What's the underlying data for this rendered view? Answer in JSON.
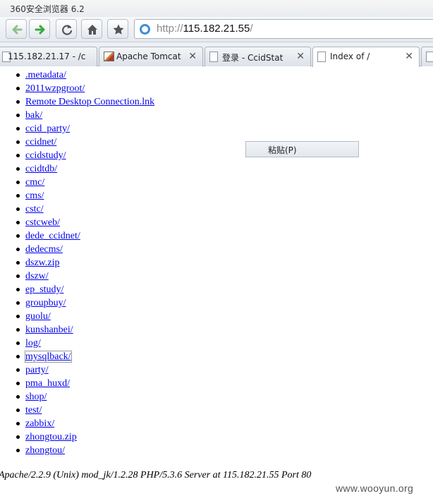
{
  "window": {
    "title": "360安全浏览器 6.2"
  },
  "address": {
    "scheme": "http://",
    "host": "115.182.21.55",
    "path": "/"
  },
  "tabs": [
    {
      "label": "115.182.21.17 - /c",
      "icon": "page-icon",
      "active": false
    },
    {
      "label": "Apache Tomcat",
      "icon": "tomcat-icon",
      "active": false
    },
    {
      "label": "登录 - CcidStat",
      "icon": "page-icon",
      "active": false
    },
    {
      "label": "Index of /",
      "icon": "page-icon",
      "active": true
    }
  ],
  "close_glyph": "✕",
  "listing": [
    ".metadata/",
    "2011wzpgroot/",
    "Remote Desktop Connection.lnk",
    "bak/",
    "ccid_party/",
    "ccidnet/",
    "ccidstudy/",
    "ccidtdb/",
    "cmc/",
    "cms/",
    "cstc/",
    "cstcweb/",
    "dede_ccidnet/",
    "dedecms/",
    "dszw.zip",
    "dszw/",
    "ep_study/",
    "groupbuy/",
    "guolu/",
    "kunshanbei/",
    "log/",
    "mysqlback/",
    "party/",
    "pma_huxd/",
    "shop/",
    "test/",
    "zabbix/",
    "zhongtou.zip",
    "zhongtou/"
  ],
  "focused_item": "mysqlback/",
  "context_menu": {
    "paste_label": "粘贴(P)"
  },
  "server_signature": "Apache/2.2.9 (Unix) mod_jk/1.2.28 PHP/5.3.6 Server at 115.182.21.55 Port 80",
  "watermark": "www.wooyun.org",
  "colors": {
    "link": "#0000ee",
    "address_icon": "#3f8fd8",
    "nav_arrow": "#3aa93a"
  }
}
